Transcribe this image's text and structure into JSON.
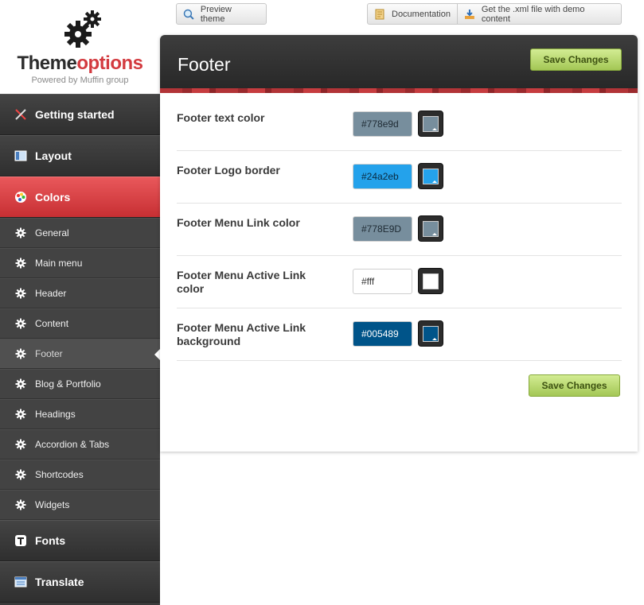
{
  "logo": {
    "title_dark": "Theme",
    "title_red": "options",
    "subtitle": "Powered by Muffin group"
  },
  "toolbar": {
    "preview_label": "Preview theme",
    "documentation_label": "Documentation",
    "xml_label": "Get the .xml file with demo content"
  },
  "sidebar": {
    "getting_started": "Getting started",
    "layout": "Layout",
    "colors": "Colors",
    "sub": [
      "General",
      "Main menu",
      "Header",
      "Content",
      "Footer",
      "Blog & Portfolio",
      "Headings",
      "Accordion & Tabs",
      "Shortcodes",
      "Widgets"
    ],
    "fonts": "Fonts",
    "translate": "Translate"
  },
  "panel": {
    "title": "Footer",
    "save_label": "Save Changes",
    "fields": [
      {
        "label": "Footer text color",
        "value": "#778e9d",
        "color": "#778e9d",
        "text_color": "#1e2a33"
      },
      {
        "label": "Footer Logo border",
        "value": "#24a2eb",
        "color": "#24a2eb",
        "text_color": "#0a2a40"
      },
      {
        "label": "Footer Menu Link color",
        "value": "#778E9D",
        "color": "#778e9d",
        "text_color": "#1e2a33"
      },
      {
        "label": "Footer Menu Active Link color",
        "value": "#fff",
        "color": "#ffffff",
        "text_color": "#333333"
      },
      {
        "label": "Footer Menu Active Link background",
        "value": "#005489",
        "color": "#005489",
        "text_color": "#ffffff"
      }
    ]
  },
  "colors": {
    "accent_red": "#d33a3f",
    "save_green": "#a3c755",
    "sidebar_dark": "#3a3a3a"
  }
}
